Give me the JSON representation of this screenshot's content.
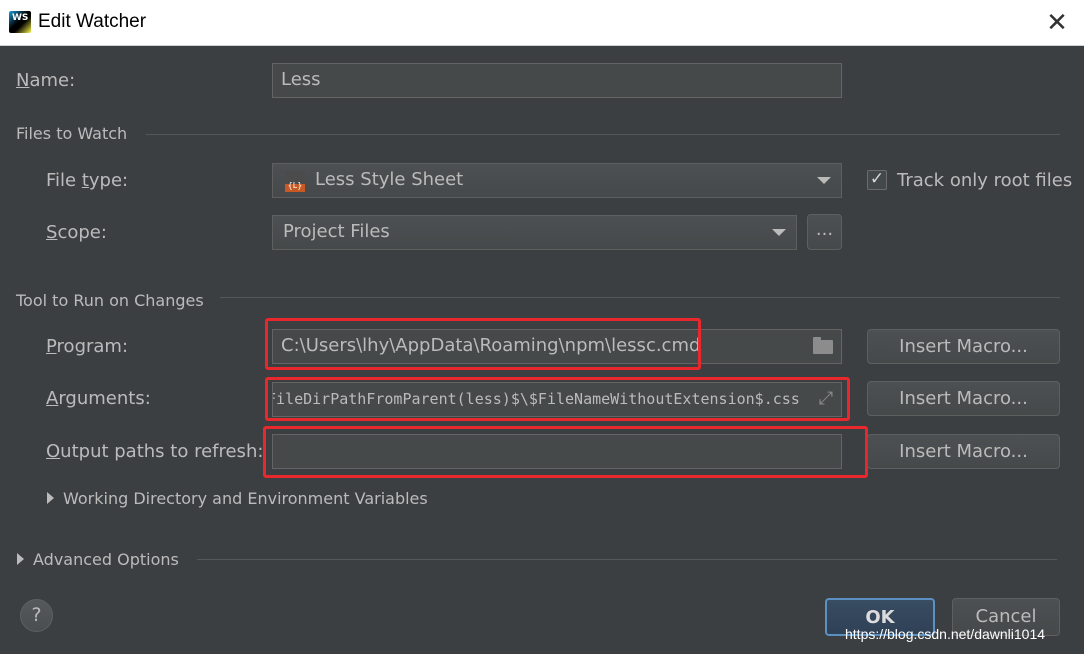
{
  "window": {
    "title": "Edit Watcher",
    "app_icon_text": "WS",
    "close_icon": "close-icon"
  },
  "name_row": {
    "label_ul": "N",
    "label_rest": "ame:",
    "value": "Less"
  },
  "files_to_watch": {
    "header": "Files to Watch",
    "file_type": {
      "label_pre": "File ",
      "label_ul": "t",
      "label_rest": "ype:",
      "value": "Less Style Sheet",
      "icon_text": "{L}"
    },
    "track_only_root": {
      "label": "Track only root files",
      "checked": true,
      "check_glyph": "✓"
    },
    "scope": {
      "label_ul": "S",
      "label_rest": "cope:",
      "value": "Project Files",
      "browse_label": "..."
    }
  },
  "tool_to_run": {
    "header": "Tool to Run on Changes",
    "program": {
      "label_ul": "P",
      "label_rest": "rogram:",
      "value": "C:\\Users\\lhy\\AppData\\Roaming\\npm\\lessc.cmd",
      "insert_macro": "Insert Macro..."
    },
    "arguments": {
      "label_ul": "A",
      "label_rest": "rguments:",
      "value": "FileDirPathFromParent(less)$\\$FileNameWithoutExtension$.css",
      "insert_macro": "Insert Macro..."
    },
    "output_paths": {
      "label_ul": "O",
      "label_rest": "utput paths to refresh:",
      "value": "",
      "insert_macro": "Insert Macro..."
    },
    "working_dir": "Working Directory and Environment Variables"
  },
  "advanced_options": "Advanced Options",
  "footer": {
    "help": "?",
    "ok": "OK",
    "cancel": "Cancel",
    "watermark": "https://blog.csdn.net/dawnli1014"
  },
  "colors": {
    "background": "#3c3f41",
    "highlight": "#e8282d",
    "ok_border": "#5c8fc2"
  }
}
